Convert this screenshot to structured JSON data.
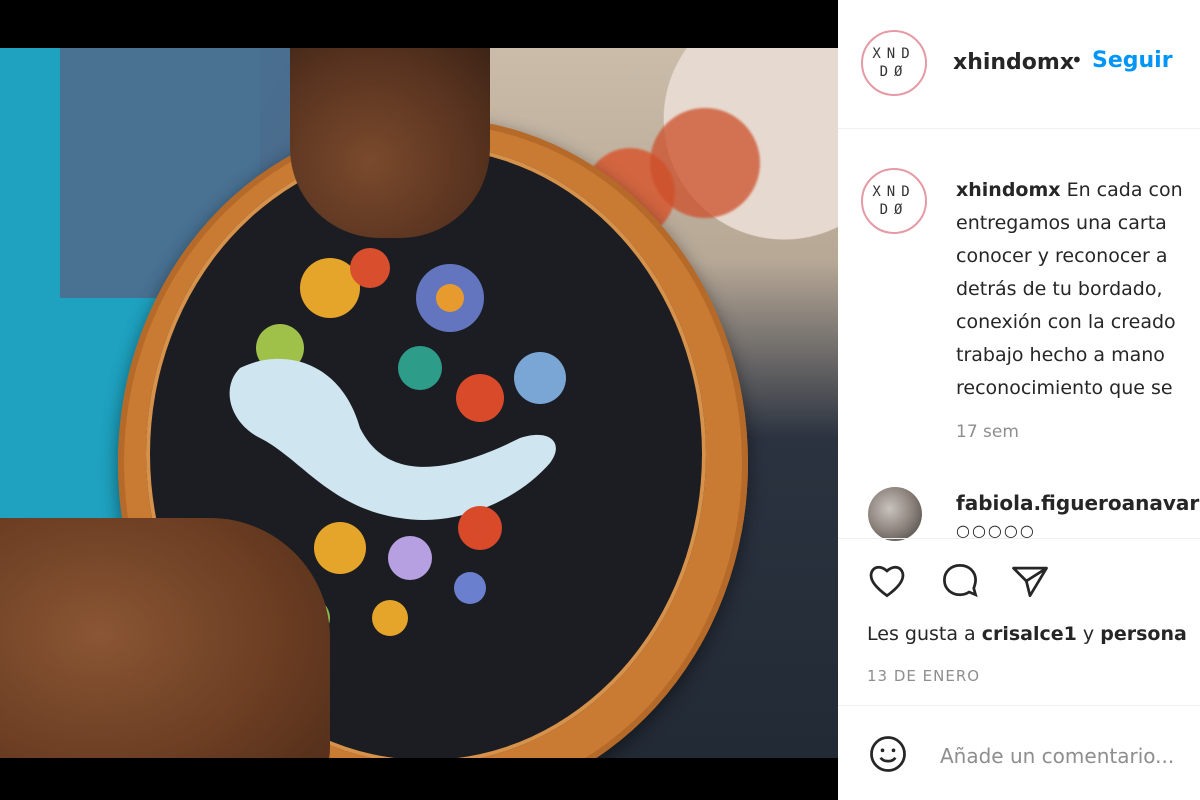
{
  "post": {
    "username": "xhindomx",
    "follow_label": "Seguir",
    "separator": "•",
    "avatar_letters_top": "XND",
    "avatar_letters_bottom": "DØ",
    "caption_lines": [
      "En cada con",
      "entregamos una carta",
      "conocer y reconocer a",
      "detrás de tu bordado,",
      "conexión con la creado",
      "trabajo hecho a mano",
      "reconocimiento que se"
    ],
    "time_ago": "17 sem",
    "comment": {
      "username": "fabiola.figueroanavarr",
      "emoji_preview": "○○○○○"
    },
    "likes_prefix": "Les gusta a",
    "likes_user": "crisalce1",
    "likes_conj": "y",
    "likes_others": "persona",
    "date": "13 DE ENERO",
    "add_comment_placeholder": "Añade un comentario..."
  },
  "icons": {
    "like": "heart-icon",
    "comment": "comment-icon",
    "share": "share-icon",
    "emoji": "emoji-icon"
  },
  "colors": {
    "follow_blue": "#0095f6",
    "text": "#262626",
    "muted": "#8e8e8e"
  }
}
